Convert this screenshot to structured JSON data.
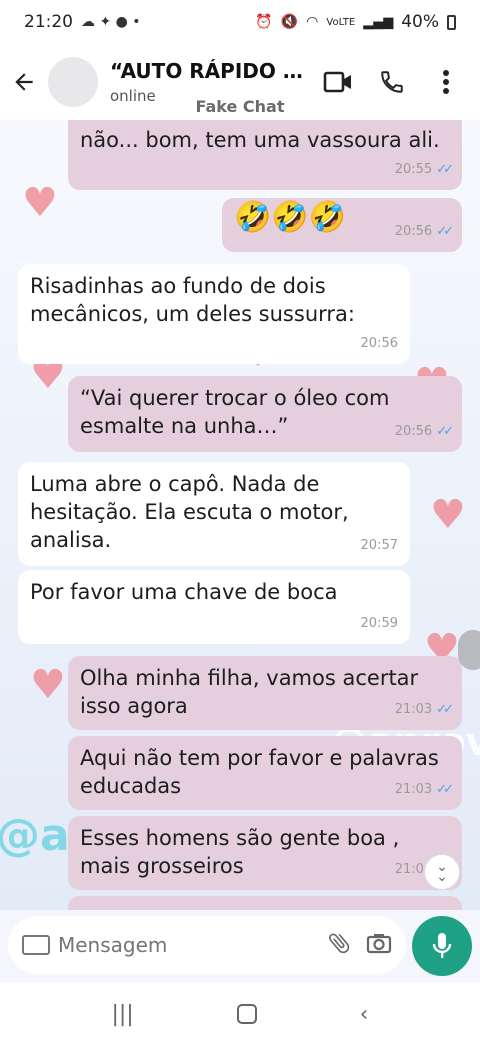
{
  "status_bar": {
    "time": "21:20",
    "battery": "40%",
    "network": "VoLTE"
  },
  "header": {
    "title": "“AUTO RÁPIDO EX...",
    "subtitle": "online",
    "fake_label": "Fake Chat"
  },
  "messages": [
    {
      "side": "out",
      "text": "não... bom, tem uma vassoura ali.",
      "time": "20:55",
      "read": true
    },
    {
      "side": "out",
      "text": "🤣🤣🤣",
      "time": "20:56",
      "read": true
    },
    {
      "side": "in",
      "text": "Risadinhas ao fundo de dois mecânicos, um deles sussurra:",
      "time": "20:56"
    },
    {
      "side": "out",
      "text": "“Vai querer trocar o óleo com esmalte na unha…”",
      "time": "20:56",
      "read": true
    },
    {
      "side": "in",
      "text": "Luma abre o capô. Nada de hesitação. Ela escuta o motor, analisa.",
      "time": "20:57"
    },
    {
      "side": "in",
      "text": "Por favor uma chave de boca",
      "time": "20:59"
    },
    {
      "side": "out",
      "text": "Olha minha filha,  vamos acertar isso agora",
      "time": "21:03",
      "read": true
    },
    {
      "side": "out",
      "text": "Aqui não tem por favor e palavras educadas",
      "time": "21:03",
      "read": true
    },
    {
      "side": "out",
      "text": "Esses homens são  gente boa , mais grosseiros",
      "time": "21:04",
      "read": true
    }
  ],
  "watermark": "@aprov",
  "composer": {
    "placeholder": "Mensagem"
  },
  "colors": {
    "out_bubble": "#e5cfdc",
    "in_bubble": "#ffffff",
    "mic": "#1fa186",
    "read_check": "#4fa3ea"
  },
  "icons": [
    "back-arrow-icon",
    "video-call-icon",
    "phone-icon",
    "more-icon",
    "keyboard-icon",
    "attach-icon",
    "camera-icon",
    "mic-icon",
    "chevron-double-down-icon"
  ]
}
